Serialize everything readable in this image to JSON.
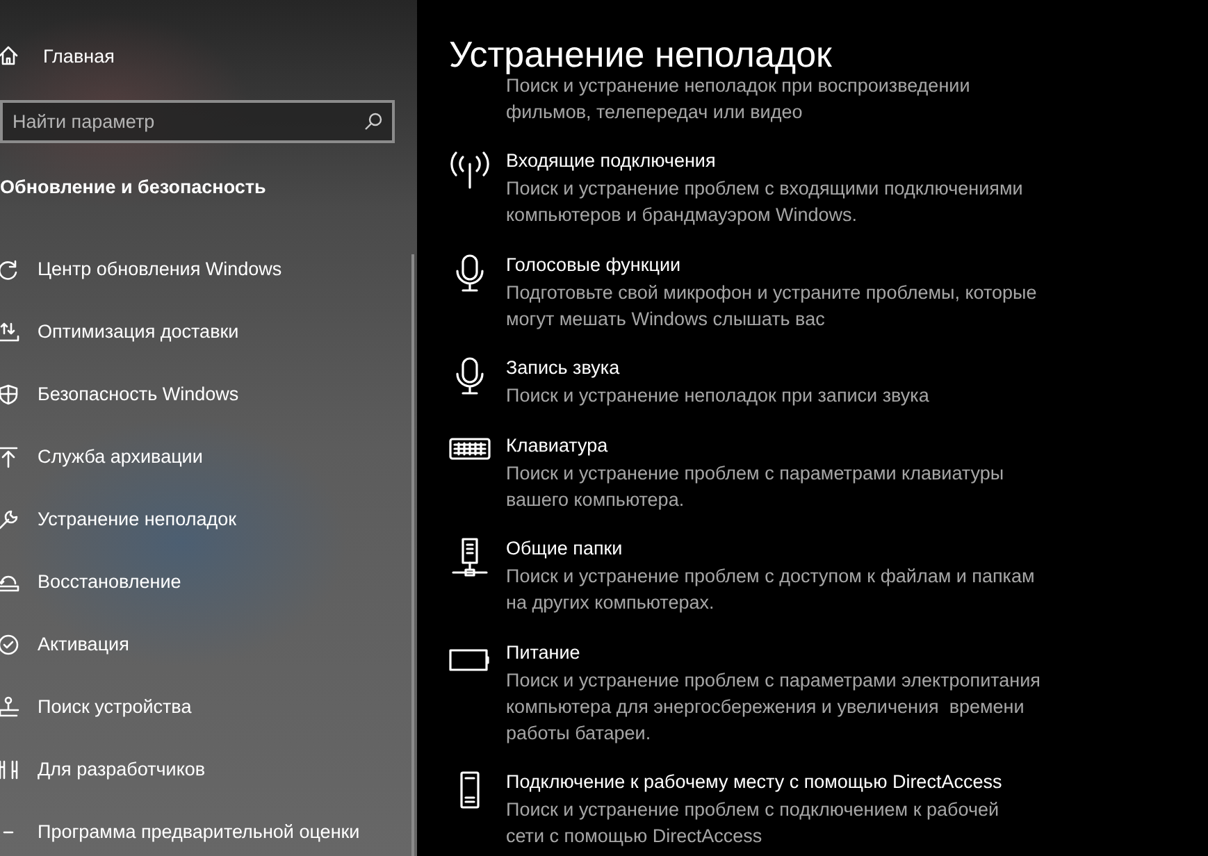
{
  "sidebar": {
    "home": {
      "label": "Главная"
    },
    "search": {
      "placeholder": "Найти параметр"
    },
    "section_title": "Обновление и безопасность",
    "items": [
      {
        "label": "Центр обновления Windows"
      },
      {
        "label": "Оптимизация доставки"
      },
      {
        "label": "Безопасность Windows"
      },
      {
        "label": "Служба архивации"
      },
      {
        "label": "Устранение неполадок"
      },
      {
        "label": "Восстановление"
      },
      {
        "label": "Активация"
      },
      {
        "label": "Поиск устройства"
      },
      {
        "label": "Для разработчиков"
      },
      {
        "label": "Программа предварительной оценки"
      }
    ]
  },
  "content": {
    "title": "Устранение неполадок",
    "items": [
      {
        "description": [
          "Поиск и устранение неполадок при воспроизведении",
          "фильмов, телепередач или видео"
        ]
      },
      {
        "title": "Входящие подключения",
        "description": [
          "Поиск и устранение проблем с входящими подключениями",
          "компьютеров и брандмауэром Windows."
        ]
      },
      {
        "title": "Голосовые функции",
        "description": [
          "Подготовьте свой микрофон и устраните проблемы, которые",
          "могут мешать Windows слышать вас"
        ]
      },
      {
        "title": "Запись звука",
        "description": [
          "Поиск и устранение неполадок при записи звука"
        ]
      },
      {
        "title": "Клавиатура",
        "description": [
          "Поиск и устранение проблем с параметрами клавиатуры",
          "вашего компьютера."
        ]
      },
      {
        "title": "Общие папки",
        "description": [
          "Поиск и устранение проблем с доступом к файлам и папкам",
          "на других компьютерах."
        ]
      },
      {
        "title": "Питание",
        "description": [
          "Поиск и устранение проблем с параметрами электропитания",
          "компьютера для энергосбережения и увеличения  времени",
          "работы батареи."
        ]
      },
      {
        "title": "Подключение к рабочему месту с помощью DirectAccess",
        "description": [
          "Поиск и устранение проблем с подключением к рабочей",
          "сети с помощью DirectAccess"
        ]
      }
    ]
  }
}
